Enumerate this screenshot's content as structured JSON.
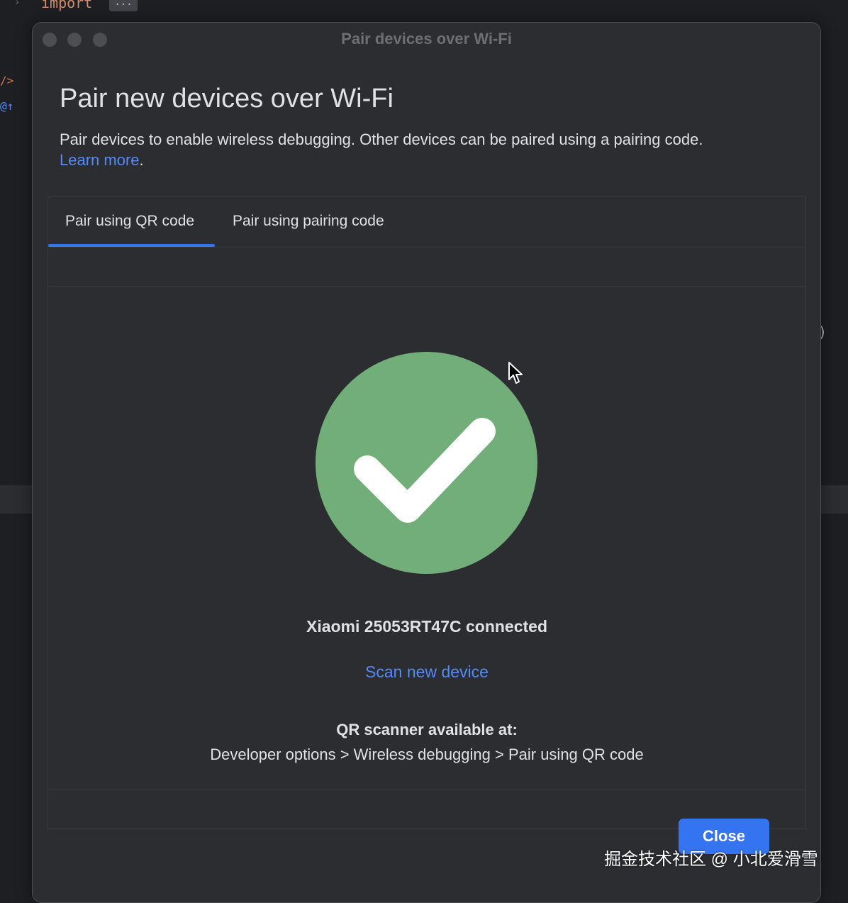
{
  "background_ide": {
    "code_text": "import",
    "fold_text": "...",
    "chevron": "›",
    "gutter_icon_1": "/>",
    "gutter_icon_2": "@↑",
    "paren": ")"
  },
  "dialog": {
    "window_title": "Pair devices over Wi-Fi",
    "heading": "Pair new devices over Wi-Fi",
    "description": "Pair devices to enable wireless debugging. Other devices can be paired using a pairing code.",
    "learn_more": "Learn more",
    "learn_more_suffix": ".",
    "tabs": [
      {
        "label": "Pair using QR code",
        "selected": true
      },
      {
        "label": "Pair using pairing code",
        "selected": false
      }
    ],
    "success_icon": "checkmark-circle-icon",
    "success_color": "#72ae7a",
    "status": "Xiaomi 25053RT47C connected",
    "scan_new_device": "Scan new device",
    "qr_scanner_label": "QR scanner available at:",
    "qr_scanner_path": "Developer options > Wireless debugging > Pair using QR code",
    "close_button": "Close",
    "accent_color": "#3574f0",
    "link_color": "#548af7"
  },
  "watermark": "掘金技术社区 @ 小北爱滑雪"
}
